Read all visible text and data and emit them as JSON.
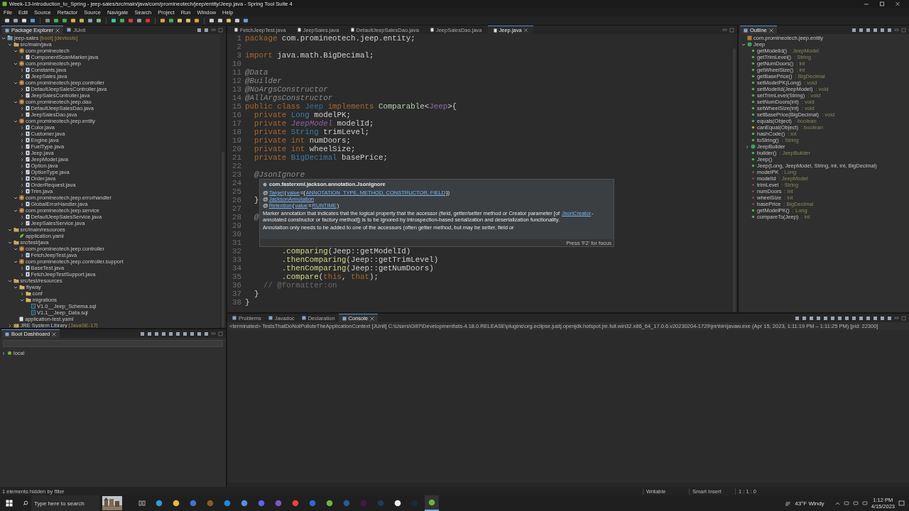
{
  "window": {
    "title": "Week-13-Introduction_to_Spring - jeep-sales/src/main/java/com/promineotech/jeep/entity/Jeep.java - Spring Tool Suite 4"
  },
  "menu": [
    "File",
    "Edit",
    "Source",
    "Refactor",
    "Source",
    "Navigate",
    "Search",
    "Project",
    "Run",
    "Window",
    "Help"
  ],
  "package_explorer": {
    "tabs": [
      {
        "label": "Package Explorer",
        "selected": true,
        "closable": true
      },
      {
        "label": "JUnit",
        "selected": false,
        "closable": false
      }
    ],
    "tree": [
      {
        "kind": "project",
        "label": "jeep-sales",
        "decoration": "[boot] [devtools]",
        "expanded": true,
        "children": [
          {
            "kind": "source",
            "label": "src/main/java",
            "expanded": true,
            "children": [
              {
                "kind": "package",
                "label": "com.promineotech",
                "expanded": true,
                "children": [
                  {
                    "kind": "interface",
                    "label": "ComponentScanMarker.java",
                    "expanded": false
                  }
                ]
              },
              {
                "kind": "package",
                "label": "com.promineotech.jeep",
                "expanded": true,
                "children": [
                  {
                    "kind": "class",
                    "label": "Constants.java",
                    "expanded": false
                  },
                  {
                    "kind": "class",
                    "label": "JeepSales.java",
                    "expanded": false
                  }
                ]
              },
              {
                "kind": "package",
                "label": "com.promineotech.jeep.controller",
                "expanded": true,
                "children": [
                  {
                    "kind": "class",
                    "label": "DefaultJeepSalesController.java",
                    "expanded": false
                  },
                  {
                    "kind": "interface",
                    "label": "JeepSalesController.java",
                    "expanded": false
                  }
                ]
              },
              {
                "kind": "package",
                "label": "com.promineotech.jeep.dao",
                "expanded": true,
                "children": [
                  {
                    "kind": "class",
                    "label": "DefaultJeepSalesDao.java",
                    "expanded": false
                  },
                  {
                    "kind": "interface",
                    "label": "JeepSalesDao.java",
                    "expanded": false
                  }
                ]
              },
              {
                "kind": "package",
                "label": "com.promineotech.jeep.entity",
                "expanded": true,
                "children": [
                  {
                    "kind": "class",
                    "label": "Color.java",
                    "expanded": false
                  },
                  {
                    "kind": "class",
                    "label": "Customer.java",
                    "expanded": false
                  },
                  {
                    "kind": "class",
                    "label": "Engine.java",
                    "expanded": false
                  },
                  {
                    "kind": "interface",
                    "label": "FuelType.java",
                    "expanded": false
                  },
                  {
                    "kind": "class",
                    "label": "Jeep.java",
                    "expanded": false
                  },
                  {
                    "kind": "interface",
                    "label": "JeepModel.java",
                    "expanded": false
                  },
                  {
                    "kind": "class",
                    "label": "Option.java",
                    "expanded": false
                  },
                  {
                    "kind": "interface",
                    "label": "OptionType.java",
                    "expanded": false
                  },
                  {
                    "kind": "class",
                    "label": "Order.java",
                    "expanded": false
                  },
                  {
                    "kind": "class",
                    "label": "OrderRequest.java",
                    "expanded": false
                  },
                  {
                    "kind": "class",
                    "label": "Trim.java",
                    "expanded": false
                  }
                ]
              },
              {
                "kind": "package",
                "label": "com.promineotech.jeep.errorhandler",
                "expanded": true,
                "children": [
                  {
                    "kind": "class",
                    "label": "GlobalErrorHandler.java",
                    "expanded": false
                  }
                ]
              },
              {
                "kind": "package",
                "label": "com.promineotech.jeep.service",
                "expanded": true,
                "children": [
                  {
                    "kind": "class",
                    "label": "DefaultJeepSalesService.java",
                    "expanded": false
                  },
                  {
                    "kind": "interface",
                    "label": "JeepSalesService.java",
                    "expanded": false
                  }
                ]
              }
            ]
          },
          {
            "kind": "source",
            "label": "src/main/resources",
            "expanded": true,
            "children": [
              {
                "kind": "yaml",
                "label": "application.yaml"
              }
            ]
          },
          {
            "kind": "source",
            "label": "src/test/java",
            "expanded": true,
            "children": [
              {
                "kind": "package",
                "label": "com.promineotech.jeep.controller",
                "expanded": true,
                "children": [
                  {
                    "kind": "test",
                    "label": "FetchJeepTest.java",
                    "expanded": false
                  }
                ]
              },
              {
                "kind": "package",
                "label": "com.promineotech.jeep.controller.support",
                "expanded": true,
                "children": [
                  {
                    "kind": "class",
                    "label": "BaseTest.java",
                    "expanded": false
                  },
                  {
                    "kind": "class",
                    "label": "FetchJeepTestSupport.java",
                    "expanded": false
                  }
                ]
              }
            ]
          },
          {
            "kind": "source",
            "label": "src/test/resources",
            "expanded": true,
            "children": [
              {
                "kind": "folder",
                "label": "flyway",
                "expanded": true,
                "children": [
                  {
                    "kind": "folder",
                    "label": "conf",
                    "expanded": false
                  },
                  {
                    "kind": "folder",
                    "label": "migrations",
                    "expanded": true,
                    "children": [
                      {
                        "kind": "sql",
                        "label": "V1.0__Jeep_Schema.sql"
                      },
                      {
                        "kind": "sql",
                        "label": "V1.1__Jeep_Data.sql"
                      }
                    ]
                  }
                ]
              },
              {
                "kind": "plain",
                "label": "application-test.yaml"
              }
            ]
          },
          {
            "kind": "library",
            "label": "JRE System Library",
            "decoration": "[JavaSE-17]",
            "expanded": false
          }
        ]
      }
    ]
  },
  "boot_dashboard": {
    "tabs": [
      {
        "label": "Boot Dashboard",
        "selected": true,
        "closable": true
      }
    ],
    "tree": [
      {
        "kind": "local",
        "label": "local",
        "expanded": false
      }
    ]
  },
  "editor": {
    "tabs": [
      {
        "label": "FetchJeepTest.java",
        "selected": false
      },
      {
        "label": "JeepSales.java",
        "selected": false
      },
      {
        "label": "DefaultJeepSalesDao.java",
        "selected": false
      },
      {
        "label": "JeepSalesDao.java",
        "selected": false
      },
      {
        "label": "Jeep.java",
        "selected": true
      }
    ],
    "lines": [
      {
        "number": "1",
        "tokens": [
          {
            "kind": "keyword",
            "text": "package"
          },
          {
            "kind": "plain",
            "text": " com.promineotech.jeep.entity;"
          }
        ]
      },
      {
        "number": "2"
      },
      {
        "number": "3",
        "tokens": [
          {
            "kind": "keyword",
            "text": "import"
          },
          {
            "kind": "plain",
            "text": " java.math.BigDecimal;"
          }
        ]
      },
      {
        "number": "10"
      },
      {
        "number": "11",
        "tokens": [
          {
            "kind": "annotation",
            "text": "@Data"
          }
        ]
      },
      {
        "number": "12",
        "tokens": [
          {
            "kind": "annotation",
            "text": "@Builder"
          }
        ]
      },
      {
        "number": "13",
        "tokens": [
          {
            "kind": "annotation",
            "text": "@NoArgsConstructor"
          }
        ]
      },
      {
        "number": "14",
        "tokens": [
          {
            "kind": "annotation",
            "text": "@AllArgsConstructor"
          }
        ]
      },
      {
        "number": "15",
        "tokens": [
          {
            "kind": "keyword",
            "text": "public class "
          },
          {
            "kind": "classname",
            "text": "Jeep"
          },
          {
            "kind": "keyword",
            "text": " implements "
          },
          {
            "kind": "generic",
            "text": "Comparable"
          },
          {
            "kind": "plain",
            "text": "<"
          },
          {
            "kind": "typeparam",
            "text": "Jeep"
          },
          {
            "kind": "plain",
            "text": ">{"
          }
        ]
      },
      {
        "number": "16",
        "tokens": [
          {
            "kind": "keyword",
            "text": "  private "
          },
          {
            "kind": "type",
            "text": "Long"
          },
          {
            "kind": "plain",
            "text": " modelPK;"
          }
        ]
      },
      {
        "number": "17",
        "tokens": [
          {
            "kind": "keyword",
            "text": "  private "
          },
          {
            "kind": "enum",
            "text": "JeepModel"
          },
          {
            "kind": "plain",
            "text": " modelId;"
          }
        ]
      },
      {
        "number": "18",
        "tokens": [
          {
            "kind": "keyword",
            "text": "  private "
          },
          {
            "kind": "type",
            "text": "String"
          },
          {
            "kind": "plain",
            "text": " trimLevel;"
          }
        ]
      },
      {
        "number": "19",
        "tokens": [
          {
            "kind": "keyword",
            "text": "  private int"
          },
          {
            "kind": "plain",
            "text": " numDoors;"
          }
        ]
      },
      {
        "number": "20",
        "tokens": [
          {
            "kind": "keyword",
            "text": "  private int"
          },
          {
            "kind": "plain",
            "text": " wheelSize;"
          }
        ]
      },
      {
        "number": "21",
        "tokens": [
          {
            "kind": "keyword",
            "text": "  private "
          },
          {
            "kind": "type",
            "text": "BigDecimal"
          },
          {
            "kind": "plain",
            "text": " basePrice;"
          }
        ]
      },
      {
        "number": "22"
      },
      {
        "number": "23",
        "tokens": [
          {
            "kind": "annotation",
            "text": "  @JsonIgnore"
          }
        ]
      },
      {
        "number": "24"
      },
      {
        "number": "25"
      },
      {
        "number": "26",
        "tokens": [
          {
            "kind": "plain",
            "text": "  }"
          }
        ]
      },
      {
        "number": "27"
      },
      {
        "number": "28",
        "tokens": [
          {
            "kind": "annotation",
            "text": "  @"
          }
        ]
      },
      {
        "number": "29"
      },
      {
        "number": "30"
      },
      {
        "number": "31"
      },
      {
        "number": "32",
        "tokens": [
          {
            "kind": "plain",
            "text": "        ."
          },
          {
            "kind": "method",
            "text": "comparing"
          },
          {
            "kind": "plain",
            "text": "(Jeep::getModelId)"
          }
        ]
      },
      {
        "number": "33",
        "tokens": [
          {
            "kind": "plain",
            "text": "        ."
          },
          {
            "kind": "method",
            "text": "thenComparing"
          },
          {
            "kind": "plain",
            "text": "(Jeep::getTrimLevel)"
          }
        ]
      },
      {
        "number": "34",
        "tokens": [
          {
            "kind": "plain",
            "text": "        ."
          },
          {
            "kind": "method",
            "text": "thenComparing"
          },
          {
            "kind": "plain",
            "text": "(Jeep::getNumDoors)"
          }
        ]
      },
      {
        "number": "35",
        "tokens": [
          {
            "kind": "plain",
            "text": "        ."
          },
          {
            "kind": "method",
            "text": "compare"
          },
          {
            "kind": "plain",
            "text": "("
          },
          {
            "kind": "keyword",
            "text": "this"
          },
          {
            "kind": "plain",
            "text": ", "
          },
          {
            "kind": "keyword",
            "text": "that"
          },
          {
            "kind": "plain",
            "text": ");"
          }
        ]
      },
      {
        "number": "36",
        "tokens": [
          {
            "kind": "comment",
            "text": "    // @formatter:on"
          }
        ]
      },
      {
        "number": "37",
        "tokens": [
          {
            "kind": "plain",
            "text": "  }"
          }
        ]
      },
      {
        "number": "38",
        "tokens": [
          {
            "kind": "plain",
            "text": "}"
          }
        ]
      }
    ],
    "hover": {
      "title": "com.fasterxml.jackson.annotation.JsonIgnore",
      "annotations": [
        [
          {
            "kind": "plain",
            "text": "@"
          },
          {
            "kind": "link",
            "text": "Target"
          },
          {
            "kind": "plain",
            "text": "("
          },
          {
            "kind": "link",
            "text": "value"
          },
          {
            "kind": "plain",
            "text": "={"
          },
          {
            "kind": "link",
            "text": "ANNOTATION_TYPE, METHOD, CONSTRUCTOR, FIELD"
          },
          {
            "kind": "plain",
            "text": "})"
          }
        ],
        [
          {
            "kind": "plain",
            "text": "@"
          },
          {
            "kind": "link",
            "text": "JacksonAnnotation"
          }
        ],
        [
          {
            "kind": "plain",
            "text": "@"
          },
          {
            "kind": "link",
            "text": "Retention"
          },
          {
            "kind": "plain",
            "text": "("
          },
          {
            "kind": "link",
            "text": "value"
          },
          {
            "kind": "plain",
            "text": "="
          },
          {
            "kind": "link",
            "text": "RUNTIME"
          },
          {
            "kind": "plain",
            "text": ")"
          }
        ]
      ],
      "paragraphs": [
        [
          {
            "kind": "plain",
            "text": "Marker annotation that indicates that the logical property that the accessor (field, getter/setter method or Creator parameter [of "
          },
          {
            "kind": "link",
            "text": "JsonCreator"
          },
          {
            "kind": "plain",
            "text": "-annotated constructor or factory method]) is to be ignored by introspection-based serialization and deserialization functionality."
          }
        ],
        [
          {
            "kind": "plain",
            "text": "Annotation only needs to be added to one of the accessors (often getter method, but may be setter, field or"
          }
        ]
      ],
      "footer": "Press 'F2' for focus"
    }
  },
  "outline": {
    "tabs": [
      {
        "label": "Outline",
        "selected": true,
        "closable": true
      }
    ],
    "tree": [
      {
        "kind": "package",
        "name": "com.promineotech.jeep.entity"
      },
      {
        "kind": "class",
        "name": "Jeep",
        "expanded": true,
        "children": [
          {
            "kind": "method",
            "name": "getModelId()",
            "type": ": JeepModel"
          },
          {
            "kind": "method",
            "name": "getTrimLevel()",
            "type": ": String"
          },
          {
            "kind": "method",
            "name": "getNumDoors()",
            "type": ": int"
          },
          {
            "kind": "method",
            "name": "getWheelSize()",
            "type": ": int"
          },
          {
            "kind": "method",
            "name": "getBasePrice()",
            "type": ": BigDecimal"
          },
          {
            "kind": "method",
            "name": "setModelPK(Long)",
            "type": ": void"
          },
          {
            "kind": "method",
            "name": "setModelId(JeepModel)",
            "type": ": void"
          },
          {
            "kind": "method",
            "name": "setTrimLevel(String)",
            "type": ": void"
          },
          {
            "kind": "method",
            "name": "setNumDoors(int)",
            "type": ": void"
          },
          {
            "kind": "method",
            "name": "setWheelSize(int)",
            "type": ": void"
          },
          {
            "kind": "method",
            "name": "setBasePrice(BigDecimal)",
            "type": ": void"
          },
          {
            "kind": "method",
            "name": "equals(Object)",
            "type": ": boolean"
          },
          {
            "kind": "protected",
            "name": "canEqual(Object)",
            "type": ": boolean"
          },
          {
            "kind": "method",
            "name": "hashCode()",
            "type": ": int"
          },
          {
            "kind": "method",
            "name": "toString()",
            "type": ": String"
          },
          {
            "kind": "class",
            "name": "JeepBuilder",
            "expanded": false
          },
          {
            "kind": "method",
            "name": "builder()",
            "type": ": JeepBuilder"
          },
          {
            "kind": "method",
            "name": "Jeep()"
          },
          {
            "kind": "method",
            "name": "Jeep(Long, JeepModel, String, int, int, BigDecimal)"
          },
          {
            "kind": "field",
            "name": "modelPK",
            "type": ": Long"
          },
          {
            "kind": "field",
            "name": "modelId",
            "type": ": JeepModel"
          },
          {
            "kind": "field",
            "name": "trimLevel",
            "type": ": String"
          },
          {
            "kind": "field",
            "name": "numDoors",
            "type": ": int"
          },
          {
            "kind": "field",
            "name": "wheelSize",
            "type": ": int"
          },
          {
            "kind": "field",
            "name": "basePrice",
            "type": ": BigDecimal"
          },
          {
            "kind": "method",
            "name": "getModelPK()",
            "type": ": Long"
          },
          {
            "kind": "method",
            "name": "compareTo(Jeep)",
            "type": ": int"
          }
        ]
      }
    ]
  },
  "console": {
    "tabs": [
      {
        "label": "Problems",
        "selected": false,
        "closable": false
      },
      {
        "label": "Javadoc",
        "selected": false,
        "closable": false
      },
      {
        "label": "Declaration",
        "selected": false,
        "closable": false
      },
      {
        "label": "Console",
        "selected": true,
        "closable": true
      }
    ],
    "launch": "<terminated> TestsThatDoNotPolluteTheApplicationContext [JUnit] C:\\Users\\Gill7\\Development\\sts-4.18.0.RELEASE\\plugins\\org.eclipse.justj.openjdk.hotspot.jre.full.win32.x86_64_17.0.6.v20230204-1729\\jre\\bin\\javaw.exe  (Apr 15, 2023, 1:11:19 PM – 1:11:25 PM) [pid: 22300]"
  },
  "status_bar": {
    "left": "1 elements hidden by filter",
    "items": [
      "Writable",
      "Smart Insert",
      "1 : 1 : 0"
    ]
  },
  "taskbar": {
    "search": {
      "placeholder": "Type here to search"
    },
    "weather": "43°F  Windy",
    "time": "1:12 PM",
    "date": "4/15/2023"
  }
}
